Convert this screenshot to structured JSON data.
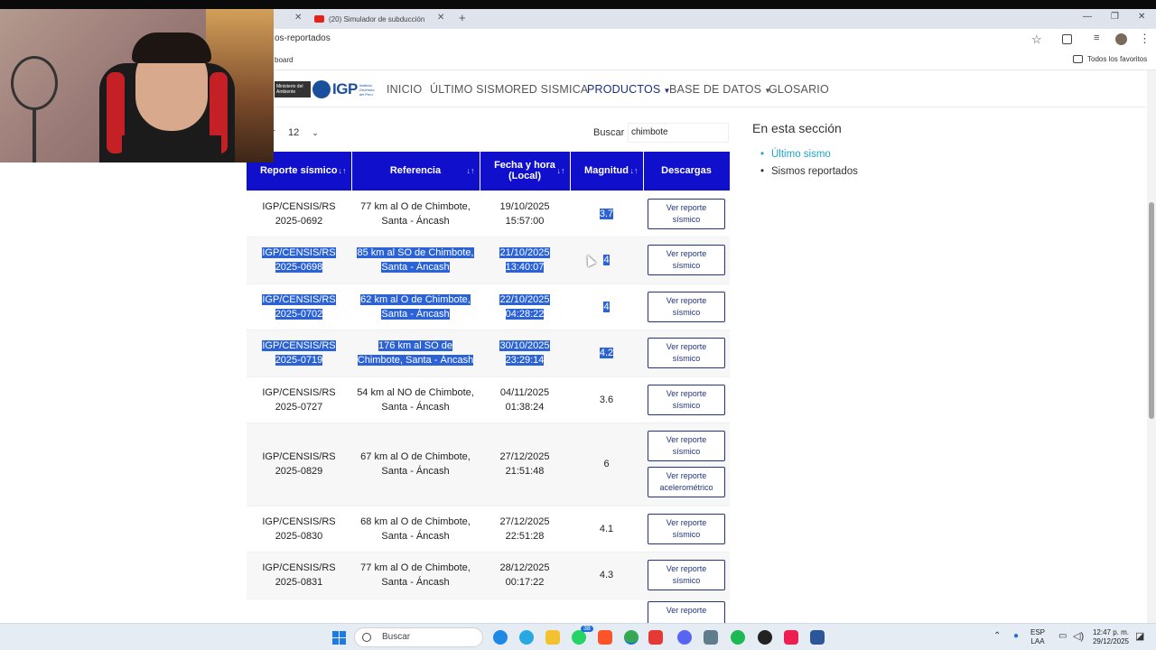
{
  "browser": {
    "tab_label": "(20) Simulador de subducción",
    "url": "os-reportados",
    "bookmark_left": "board",
    "bookmark_right": "Todos los favoritos"
  },
  "site_nav": {
    "ministry": "Ministerio del Ambiente",
    "logo": "IGP",
    "logo_sub": "Instituto Geofísico del Perú",
    "items": [
      {
        "label": "INICIO",
        "active": false
      },
      {
        "label": "ÚLTIMO SISMO",
        "active": false
      },
      {
        "label": "RED SISMICA",
        "active": false
      },
      {
        "label": "PRODUCTOS",
        "active": true
      },
      {
        "label": "BASE DE DATOS",
        "active": false
      },
      {
        "label": "GLOSARIO",
        "active": false
      }
    ]
  },
  "controls": {
    "show_label": "r",
    "show_value": "12",
    "search_label": "Buscar",
    "search_value": "chimbote"
  },
  "table": {
    "headers": [
      "Reporte sísmico",
      "Referencia",
      "Fecha y hora (Local)",
      "Magnitud",
      "Descargas"
    ],
    "rows": [
      {
        "report": [
          "IGP/CENSIS/RS",
          "2025-0692"
        ],
        "ref": [
          "77 km al O de Chimbote,",
          "Santa - Áncash"
        ],
        "date": [
          "19/10/2025",
          "15:57:00"
        ],
        "mag": "3.7",
        "buttons": [
          [
            "Ver reporte",
            "sísmico"
          ]
        ]
      },
      {
        "report": [
          "IGP/CENSIS/RS",
          "2025-0698"
        ],
        "ref": [
          "85 km al SO de Chimbote,",
          "Santa - Áncash"
        ],
        "date": [
          "21/10/2025",
          "13:40:07"
        ],
        "mag": "4",
        "buttons": [
          [
            "Ver reporte",
            "sísmico"
          ]
        ]
      },
      {
        "report": [
          "IGP/CENSIS/RS",
          "2025-0702"
        ],
        "ref": [
          "62 km al O de Chimbote,",
          "Santa - Áncash"
        ],
        "date": [
          "22/10/2025",
          "04:28:22"
        ],
        "mag": "4",
        "buttons": [
          [
            "Ver reporte",
            "sísmico"
          ]
        ]
      },
      {
        "report": [
          "IGP/CENSIS/RS",
          "2025-0719"
        ],
        "ref": [
          "176 km al SO de",
          "Chimbote, Santa - Áncash"
        ],
        "date": [
          "30/10/2025",
          "23:29:14"
        ],
        "mag": "4.2",
        "buttons": [
          [
            "Ver reporte",
            "sísmico"
          ]
        ]
      },
      {
        "report": [
          "IGP/CENSIS/RS",
          "2025-0727"
        ],
        "ref": [
          "54 km al NO de Chimbote,",
          "Santa - Áncash"
        ],
        "date": [
          "04/11/2025",
          "01:38:24"
        ],
        "mag": "3.6",
        "buttons": [
          [
            "Ver reporte",
            "sísmico"
          ]
        ]
      },
      {
        "report": [
          "IGP/CENSIS/RS",
          "2025-0829"
        ],
        "ref": [
          "67 km al O de Chimbote,",
          "Santa - Áncash"
        ],
        "date": [
          "27/12/2025",
          "21:51:48"
        ],
        "mag": "6",
        "buttons": [
          [
            "Ver reporte",
            "sísmico"
          ],
          [
            "Ver reporte",
            "acelerométrico"
          ]
        ]
      },
      {
        "report": [
          "IGP/CENSIS/RS",
          "2025-0830"
        ],
        "ref": [
          "68 km al O de Chimbote,",
          "Santa - Áncash"
        ],
        "date": [
          "27/12/2025",
          "22:51:28"
        ],
        "mag": "4.1",
        "buttons": [
          [
            "Ver reporte",
            "sísmico"
          ]
        ]
      },
      {
        "report": [
          "IGP/CENSIS/RS",
          "2025-0831"
        ],
        "ref": [
          "77 km al O de Chimbote,",
          "Santa - Áncash"
        ],
        "date": [
          "28/12/2025",
          "00:17:22"
        ],
        "mag": "4.3",
        "buttons": [
          [
            "Ver reporte",
            "sísmico"
          ]
        ]
      },
      {
        "report": [
          "",
          ""
        ],
        "ref": [
          "",
          ""
        ],
        "date": [
          "",
          ""
        ],
        "mag": "",
        "buttons": [
          [
            "Ver reporte",
            ""
          ]
        ]
      }
    ]
  },
  "sidebar": {
    "title": "En esta sección",
    "items": [
      {
        "label": "Último sismo",
        "link": true
      },
      {
        "label": "Sismos reportados",
        "link": false
      }
    ]
  },
  "taskbar": {
    "search_placeholder": "Buscar",
    "badge": "38",
    "lang_top": "ESP",
    "lang_bottom": "LAA",
    "time": "12:47 p. m.",
    "date": "29/12/2025"
  },
  "colors": {
    "table_header": "#1010cc",
    "selection": "#2b63d6",
    "link": "#1fa6c8",
    "nav_active": "#1a2f7a"
  }
}
